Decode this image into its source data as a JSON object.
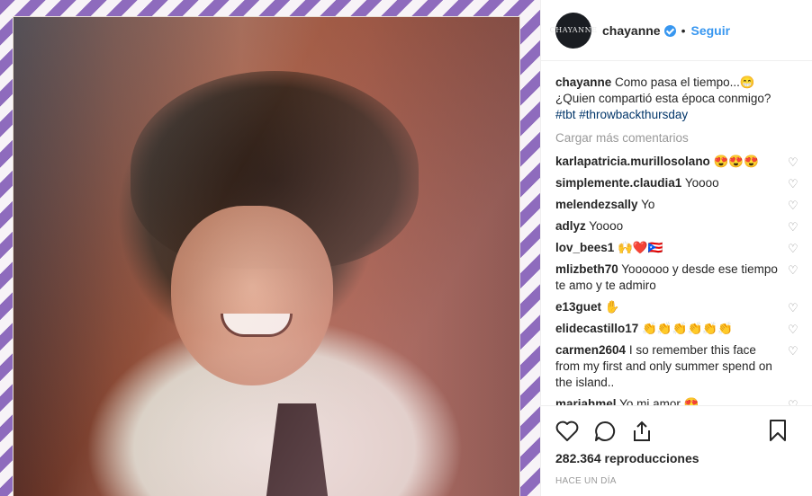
{
  "author": {
    "avatar_text": "CHAYANNE",
    "username": "chayanne",
    "separator": "•",
    "follow_label": "Seguir"
  },
  "caption": {
    "username": "chayanne",
    "line1": "Como pasa el tiempo...😁",
    "line2": "¿Quien compartió esta época conmigo?",
    "hashtags": "#tbt #throwbackthursday"
  },
  "load_more": "Cargar más comentarios",
  "comments": [
    {
      "user": "karlapatricia.murillosolano",
      "text": "😍😍😍"
    },
    {
      "user": "simplemente.claudia1",
      "text": "Yoooo"
    },
    {
      "user": "melendezsally",
      "text": "Yo"
    },
    {
      "user": "adlyz",
      "text": "Yoooo"
    },
    {
      "user": "lov_bees1",
      "text": "🙌❤️🇵🇷"
    },
    {
      "user": "mlizbeth70",
      "text": "Yoooooo y desde ese tiempo te amo y te admiro"
    },
    {
      "user": "e13guet",
      "text": "✋"
    },
    {
      "user": "elidecastillo17",
      "text": "👏👏👏👏👏👏"
    },
    {
      "user": "carmen2604",
      "text": "I so remember this face from my first and only summer spend on the island.."
    },
    {
      "user": "mariahmel",
      "text": "Yo mi amor 😍"
    }
  ],
  "icons": [
    "heart-icon",
    "comment-icon",
    "share-icon",
    "bookmark-icon"
  ],
  "views": "282.364 reproducciones",
  "timestamp": "HACE UN DÍA",
  "colors": {
    "accent": "#3897f0",
    "hashtag": "#003569",
    "border_purple": "#8e6bbd"
  }
}
